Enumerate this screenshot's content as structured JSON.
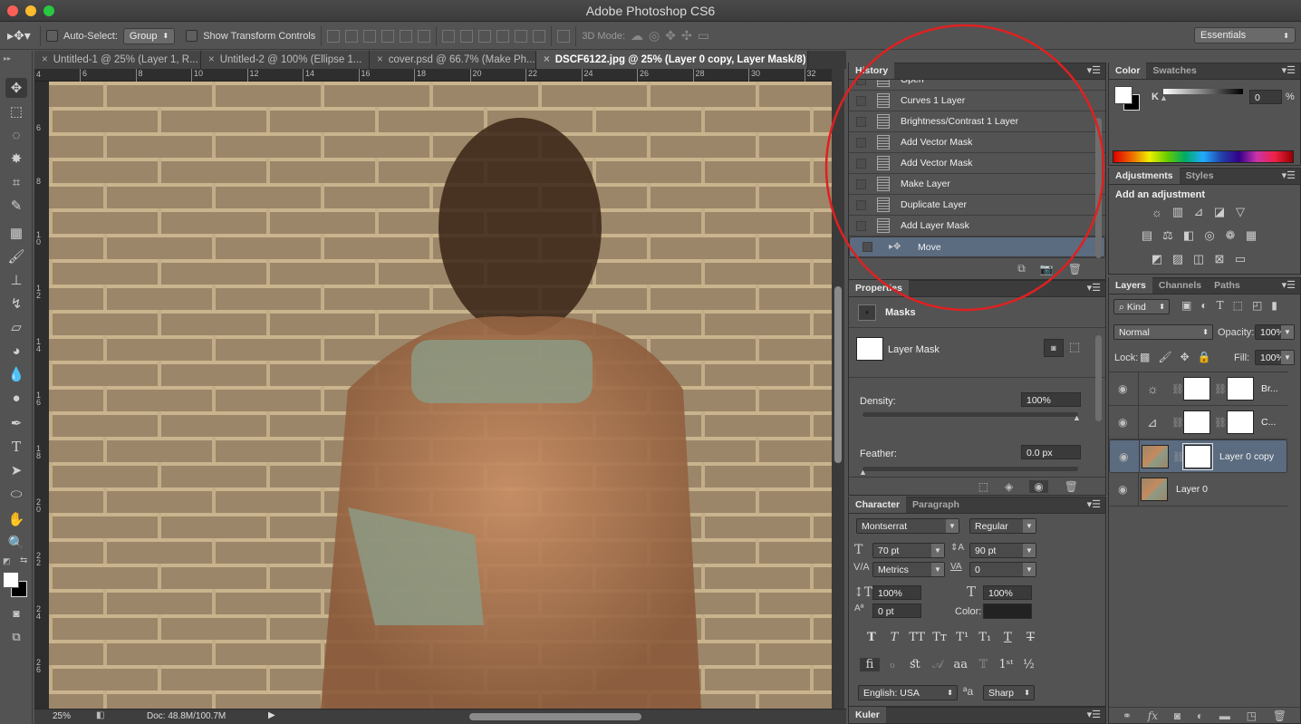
{
  "window": {
    "title": "Adobe Photoshop CS6"
  },
  "options_bar": {
    "auto_select_label": "Auto-Select:",
    "auto_select_value": "Group",
    "show_transform_label": "Show Transform Controls",
    "mode_3d_label": "3D Mode:",
    "workspace": "Essentials"
  },
  "doc_tabs": [
    {
      "label": "Untitled-1 @ 25% (Layer 1, R...",
      "active": false
    },
    {
      "label": "Untitled-2 @ 100% (Ellipse 1...",
      "active": false
    },
    {
      "label": "cover.psd @ 66.7% (Make Ph...",
      "active": false
    },
    {
      "label": "DSCF6122.jpg @ 25% (Layer 0 copy, Layer Mask/8) *",
      "active": true
    }
  ],
  "rulers": {
    "horizontal": [
      "6",
      "8",
      "10",
      "12",
      "14",
      "16",
      "18",
      "20",
      "22",
      "24",
      "26",
      "28",
      "30",
      "32"
    ],
    "vertical": [
      "4",
      "6",
      "8",
      "10",
      "12",
      "14",
      "16",
      "18",
      "20",
      "22",
      "24",
      "26"
    ]
  },
  "status": {
    "zoom": "25%",
    "doc": "Doc: 48.8M/100.7M"
  },
  "history": {
    "tab": "History",
    "items": [
      {
        "label": "Open",
        "selected": false
      },
      {
        "label": "Curves 1 Layer",
        "selected": false
      },
      {
        "label": "Brightness/Contrast 1 Layer",
        "selected": false
      },
      {
        "label": "Add Vector Mask",
        "selected": false
      },
      {
        "label": "Add Vector Mask",
        "selected": false
      },
      {
        "label": "Make Layer",
        "selected": false
      },
      {
        "label": "Duplicate Layer",
        "selected": false
      },
      {
        "label": "Add Layer Mask",
        "selected": false
      },
      {
        "label": "Move",
        "selected": true
      }
    ]
  },
  "color_panel": {
    "tabs": [
      "Color",
      "Swatches"
    ],
    "channel": "K",
    "value": "0",
    "unit": "%"
  },
  "adjustments": {
    "tabs": [
      "Adjustments",
      "Styles"
    ],
    "heading": "Add an adjustment"
  },
  "properties": {
    "tab": "Properties",
    "section": "Masks",
    "mask_label": "Layer Mask",
    "density_label": "Density:",
    "density_value": "100%",
    "density_fraction": 1.0,
    "feather_label": "Feather:",
    "feather_value": "0.0 px",
    "feather_fraction": 0.0
  },
  "character": {
    "tabs": [
      "Character",
      "Paragraph"
    ],
    "font_family": "Montserrat",
    "font_style": "Regular",
    "size": "70 pt",
    "leading": "90 pt",
    "kerning": "Metrics",
    "tracking": "0",
    "vscale": "100%",
    "hscale": "100%",
    "baseline": "0 pt",
    "color_label": "Color:",
    "color": "#222222",
    "language": "English: USA",
    "antialias": "Sharp"
  },
  "kuler": {
    "tab": "Kuler"
  },
  "layers": {
    "tabs": [
      "Layers",
      "Channels",
      "Paths"
    ],
    "filter_kind": "Kind",
    "blend_mode": "Normal",
    "opacity_label": "Opacity:",
    "opacity": "100%",
    "lock_label": "Lock:",
    "fill_label": "Fill:",
    "fill": "100%",
    "items": [
      {
        "name": "Br...",
        "type": "brightness-contrast",
        "selected": false
      },
      {
        "name": "C...",
        "type": "curves",
        "selected": false
      },
      {
        "name": "Layer 0 copy",
        "type": "pixel-with-mask",
        "selected": true
      },
      {
        "name": "Layer 0",
        "type": "pixel",
        "selected": false
      }
    ]
  },
  "annotation": {
    "color": "#e02020",
    "shape": "circle around History panel"
  }
}
